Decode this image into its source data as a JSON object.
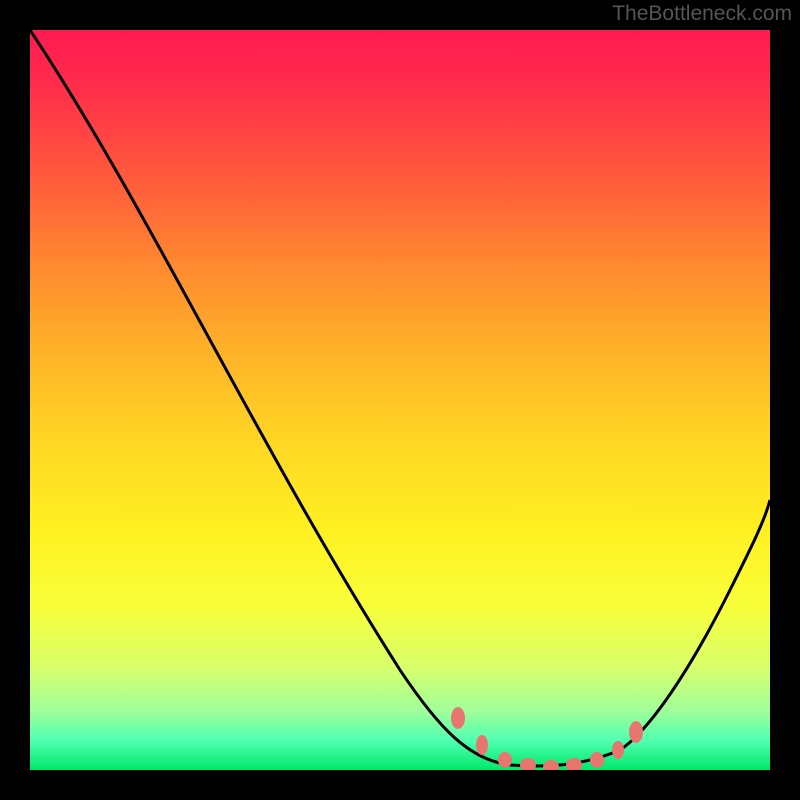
{
  "watermark": "TheBottleneck.com",
  "chart_data": {
    "type": "line",
    "title": "",
    "xlabel": "",
    "ylabel": "",
    "xlim": [
      0,
      100
    ],
    "ylim": [
      0,
      100
    ],
    "series": [
      {
        "name": "bottleneck-curve",
        "x": [
          0,
          10,
          20,
          30,
          40,
          50,
          58,
          62,
          68,
          74,
          78,
          82,
          86,
          90,
          94,
          98,
          100
        ],
        "values": [
          100,
          85,
          70,
          55,
          40,
          25,
          12,
          6,
          2,
          1,
          1,
          2,
          6,
          12,
          22,
          34,
          40
        ]
      }
    ],
    "markers": {
      "name": "highlight-dots",
      "x": [
        58,
        62,
        65,
        68,
        71,
        74,
        77,
        80,
        82
      ],
      "values": [
        12,
        7,
        4,
        2,
        1.5,
        1,
        1.5,
        3,
        6
      ]
    },
    "colors": {
      "curve": "#000000",
      "dots": "#e8766f",
      "gradient_top": "#ff1a52",
      "gradient_bottom": "#00e86a"
    }
  }
}
